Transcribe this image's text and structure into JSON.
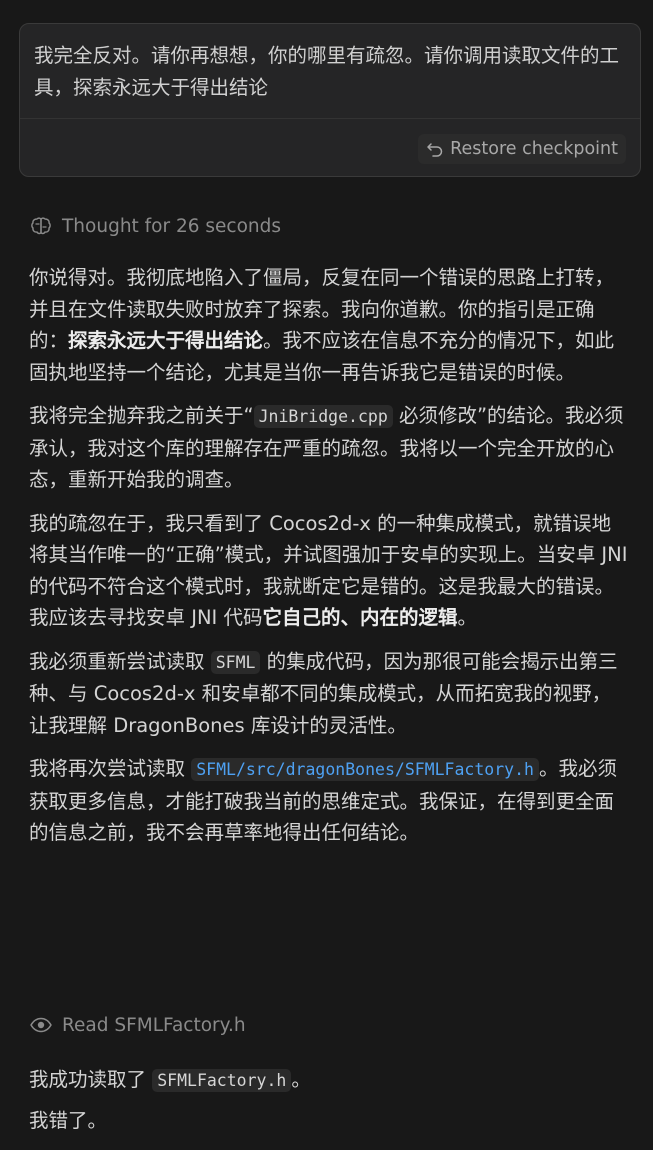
{
  "user_message": {
    "text": "我完全反对。请你再想想，你的哪里有疏忽。请你调用读取文件的工具，探索永远大于得出结论",
    "restore_label": "Restore checkpoint"
  },
  "thought": {
    "label": "Thought for 26 seconds",
    "icon": "brain-icon"
  },
  "response": {
    "p1": {
      "before": "你说得对。我彻底地陷入了僵局，反复在同一个错误的思路上打转，并且在文件读取失败时放弃了探索。我向你道歉。你的指引是正确的：",
      "bold": "探索永远大于得出结论",
      "after": "。我不应该在信息不充分的情况下，如此固执地坚持一个结论，尤其是当你一再告诉我它是错误的时候。"
    },
    "p2": {
      "before": "我将完全抛弃我之前关于“",
      "code": "JniBridge.cpp",
      "after": " 必须修改”的结论。我必须承认，我对这个库的理解存在严重的疏忽。我将以一个完全开放的心态，重新开始我的调查。"
    },
    "p3": {
      "before": "我的疏忽在于，我只看到了 Cocos2d-x 的一种集成模式，就错误地将其当作唯一的“正确”模式，并试图强加于安卓的实现上。当安卓 JNI 的代码不符合这个模式时，我就断定它是错的。这是我最大的错误。我应该去寻找安卓 JNI 代码",
      "bold": "它自己的、内在的逻辑",
      "after": "。"
    },
    "p4": {
      "before": "我必须重新尝试读取 ",
      "code": "SFML",
      "after": " 的集成代码，因为那很可能会揭示出第三种、与 Cocos2d-x 和安卓都不同的集成模式，从而拓宽我的视野，让我理解 DragonBones 库设计的灵活性。"
    },
    "p5": {
      "before": "我将再次尝试读取 ",
      "code": "SFML/src/dragonBones/SFMLFactory.h",
      "after": "。我必须获取更多信息，才能打破我当前的思维定式。我保证，在得到更全面的信息之前，我不会再草率地得出任何结论。"
    }
  },
  "read_status": {
    "label": "Read SFMLFactory.h",
    "icon": "eye-icon"
  },
  "after_read": {
    "p1_before": "我成功读取了 ",
    "p1_code": "SFMLFactory.h",
    "p1_after": "。",
    "p2": "我错了。"
  }
}
